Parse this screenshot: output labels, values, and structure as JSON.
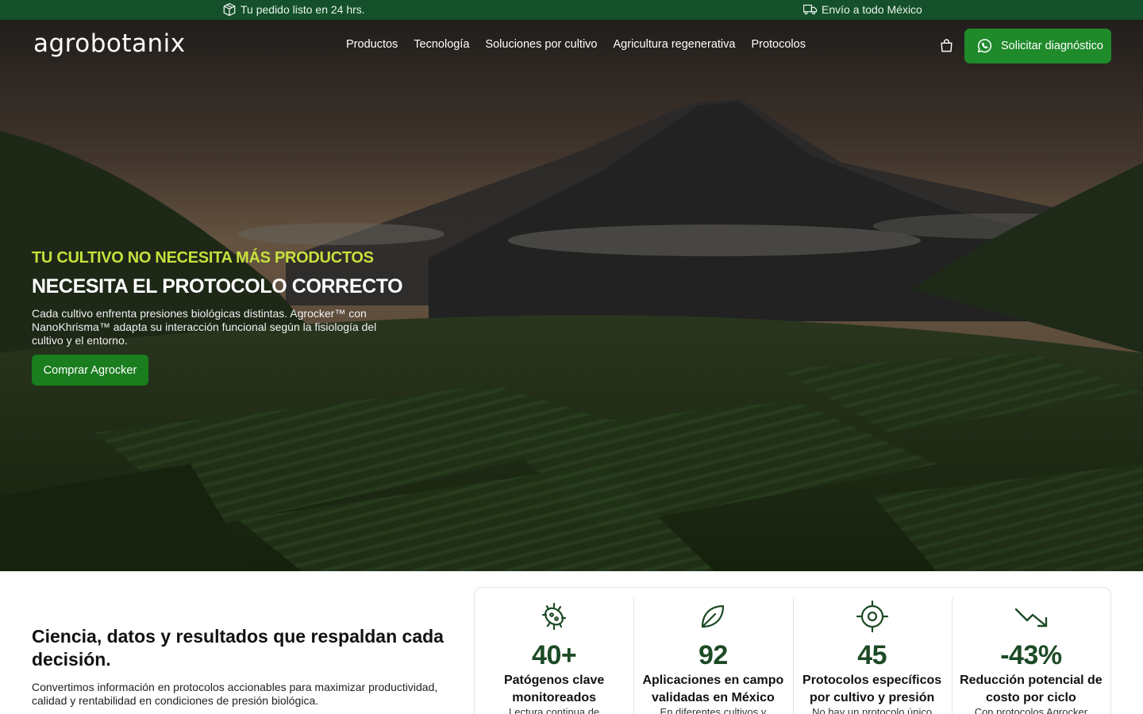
{
  "topbar": {
    "left_text": "Tu pedido listo en 24 hrs.",
    "left_icon": "package-icon",
    "right_text": "Envío a todo México",
    "right_icon": "truck-icon",
    "bg_color": "#14502a"
  },
  "header": {
    "logo": "agrobotanix",
    "nav": [
      "Productos",
      "Tecnología",
      "Soluciones por cultivo",
      "Agricultura regenerativa",
      "Protocolos"
    ],
    "cart_icon": "shopping-bag-icon",
    "cta_label": "Solicitar diagnóstico",
    "cta_icon": "whatsapp-icon"
  },
  "hero": {
    "kicker": "TU CULTIVO NO NECESITA MÁS PRODUCTOS",
    "headline": "NECESITA EL PROTOCOLO CORRECTO",
    "description": "Cada cultivo enfrenta presiones biológicas distintas. Agrocker™ con NanoKhrisma™ adapta su interacción funcional según la fisiología del cultivo y el entorno.",
    "button_label": "Comprar Agrocker",
    "accent_color": "#c6e03c",
    "button_color": "#1a7d1e"
  },
  "stats_section": {
    "title": "Ciencia, datos y resultados que respaldan cada decisión.",
    "description": "Convertimos información en protocolos accionables para maximizar productividad, calidad y rentabilidad en condiciones de presión biológica.",
    "items": [
      {
        "icon": "microbe-icon",
        "value": "40+",
        "label": "Patógenos clave monitoreados",
        "sub": "Lectura continua de"
      },
      {
        "icon": "leaf-icon",
        "value": "92",
        "label": "Aplicaciones en campo validadas en México",
        "sub": "En diferentes cultivos y"
      },
      {
        "icon": "target-icon",
        "value": "45",
        "label": "Protocolos específicos por cultivo y presión",
        "sub": "No hay un protocolo único"
      },
      {
        "icon": "trending-down-icon",
        "value": "-43%",
        "label": "Reducción potencial de costo por ciclo",
        "sub": "Con protocolos Agrocker"
      }
    ]
  }
}
